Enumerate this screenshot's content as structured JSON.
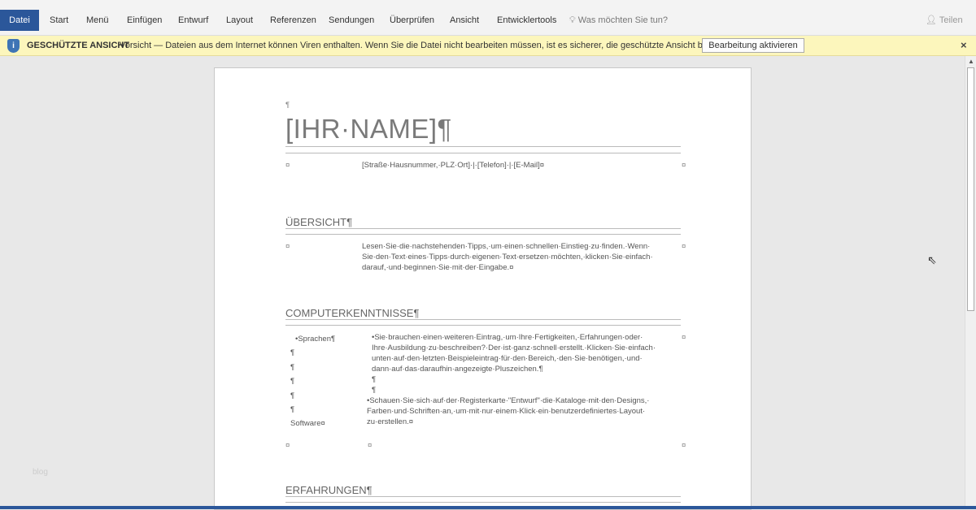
{
  "ribbon": {
    "tabs": [
      "Datei",
      "Start",
      "Menü",
      "Einfügen",
      "Entwurf",
      "Layout",
      "Referenzen",
      "Sendungen",
      "Überprüfen",
      "Ansicht",
      "Entwicklertools"
    ],
    "tell_me": "Was möchten Sie tun?",
    "share": "Teilen"
  },
  "protected_view": {
    "title": "GESCHÜTZTE ANSICHT",
    "message": "Vorsicht — Dateien aus dem Internet können Viren enthalten. Wenn Sie die Datei nicht bearbeiten müssen, ist es sicherer, die geschützte Ansicht beizubehalten.",
    "button": "Bearbeitung aktivieren",
    "close": "×"
  },
  "doc": {
    "pilcrow": "¶",
    "cell": "¤",
    "name": "[IHR·NAME]¶",
    "contact": "[Straße·Hausnummer,·PLZ·Ort]·|·[Telefon]·|·[E-Mail]¤",
    "overview_heading": "ÜBERSICHT¶",
    "overview_lines": [
      "Lesen·Sie·die·nachstehenden·Tipps,·um·einen·schnellen·Einstieg·zu·finden.·Wenn·",
      "Sie·den·Text·eines·Tipps·durch·eigenen·Text·ersetzen·möchten,·klicken·Sie·einfach·",
      "darauf,·und·beginnen·Sie·mit·der·Eingabe.¤"
    ],
    "skills_heading": "COMPUTERKENNTNISSE¶",
    "skills_left": [
      "•Sprachen¶",
      "¶",
      "¶",
      "¶",
      "¶",
      "¶",
      "Software¤"
    ],
    "skills_right": [
      "•Sie·brauchen·einen·weiteren·Eintrag,·um·Ihre·Fertigkeiten,·Erfahrungen·oder·",
      "Ihre·Ausbildung·zu·beschreiben?·Der·ist·ganz·schnell·erstellt.·Klicken·Sie·einfach·",
      "unten·auf·den·letzten·Beispieleintrag·für·den·Bereich,·den·Sie·benötigen,·und·",
      "dann·auf·das·daraufhin·angezeigte·Pluszeichen.¶",
      "¶",
      "¶",
      "•Schauen·Sie·sich·auf·der·Registerkarte·\"Entwurf\"·die·Kataloge·mit·den·Designs,·",
      "Farben·und·Schriften·an,·um·mit·nur·einem·Klick·ein·benutzerdefiniertes·Layout·",
      "zu·erstellen.¤"
    ],
    "experience_heading": "ERFAHRUNGEN¶"
  },
  "watermark": "blog",
  "colors": {
    "accent": "#2b579a",
    "warning_bar": "#fcf6bc"
  }
}
